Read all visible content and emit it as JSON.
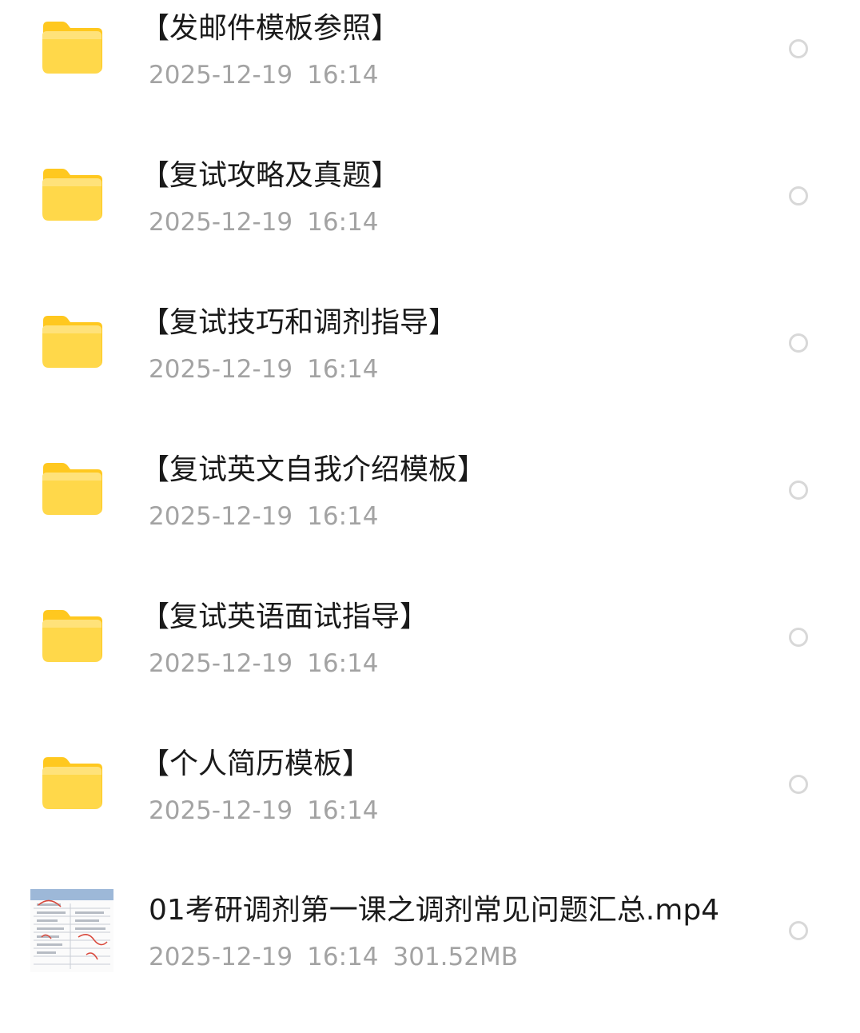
{
  "colors": {
    "folder_light": "#FFE27A",
    "folder_dark": "#FFC81F",
    "title_text": "#1A1A1A",
    "meta_text": "#A3A3A3",
    "radio_border": "#D8D8D8"
  },
  "items": [
    {
      "type": "folder",
      "icon": "folder-icon",
      "name": "【发邮件模板参照】",
      "date": "2025-12-19",
      "time": "16:14"
    },
    {
      "type": "folder",
      "icon": "folder-icon",
      "name": "【复试攻略及真题】",
      "date": "2025-12-19",
      "time": "16:14"
    },
    {
      "type": "folder",
      "icon": "folder-icon",
      "name": "【复试技巧和调剂指导】",
      "date": "2025-12-19",
      "time": "16:14"
    },
    {
      "type": "folder",
      "icon": "folder-icon",
      "name": "【复试英文自我介绍模板】",
      "date": "2025-12-19",
      "time": "16:14"
    },
    {
      "type": "folder",
      "icon": "folder-icon",
      "name": "【复试英语面试指导】",
      "date": "2025-12-19",
      "time": "16:14"
    },
    {
      "type": "folder",
      "icon": "folder-icon",
      "name": "【个人简历模板】",
      "date": "2025-12-19",
      "time": "16:14"
    },
    {
      "type": "file",
      "icon": "video-thumbnail",
      "name": "01考研调剂第一课之调剂常见问题汇总.mp4",
      "date": "2025-12-19",
      "time": "16:14",
      "size": "301.52MB"
    }
  ]
}
